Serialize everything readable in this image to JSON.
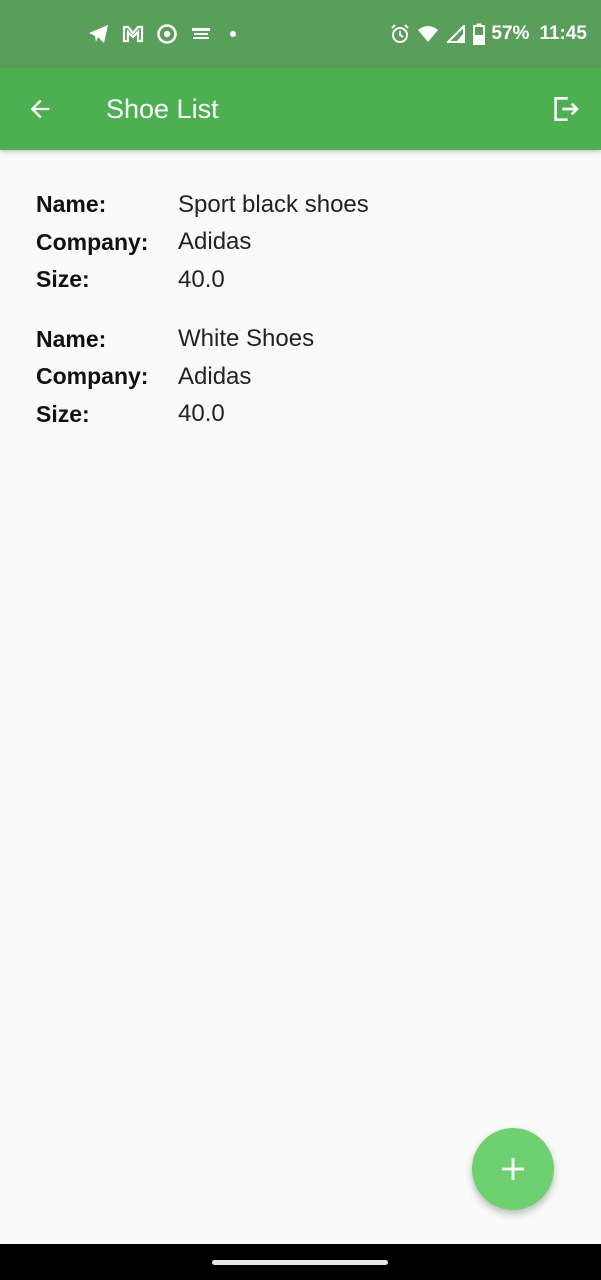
{
  "status_bar": {
    "battery": "57%",
    "time": "11:45",
    "notification_icons": [
      "telegram-icon",
      "gmail-icon",
      "chrome-icon",
      "app-icon",
      "dot-icon"
    ],
    "system_icons": [
      "alarm-icon",
      "wifi-icon",
      "signal-icon",
      "battery-icon"
    ]
  },
  "app_bar": {
    "title": "Shoe List",
    "color": "#4caf50"
  },
  "shoes": [
    {
      "name_label": "Name:",
      "name": "Sport black shoes",
      "company_label": "Company:",
      "company": "Adidas",
      "size_label": "Size:",
      "size": "40.0"
    },
    {
      "name_label": "Name:",
      "name": "White Shoes",
      "company_label": "Company:",
      "company": "Adidas",
      "size_label": "Size:",
      "size": "40.0"
    }
  ],
  "fab": {
    "icon": "plus-icon",
    "color": "#6dd16f"
  }
}
